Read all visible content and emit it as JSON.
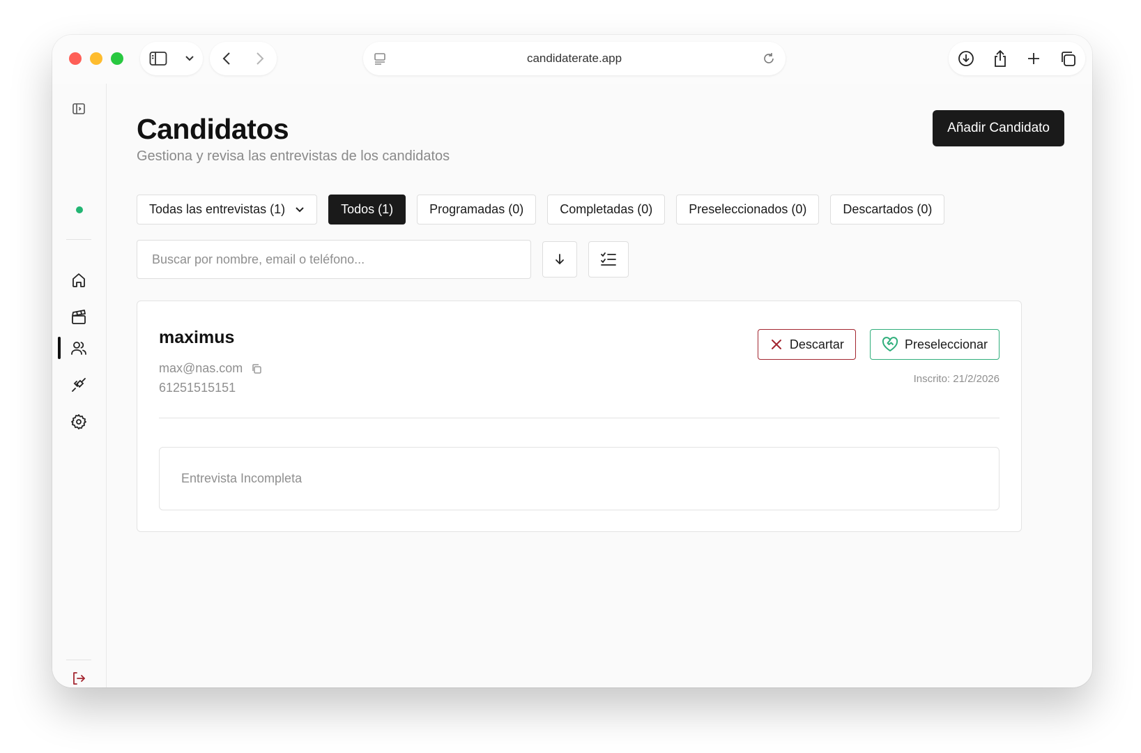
{
  "browser": {
    "url": "candidaterate.app"
  },
  "page": {
    "title": "Candidatos",
    "subtitle": "Gestiona y revisa las entrevistas de los candidatos",
    "add_button": "Añadir Candidato"
  },
  "filters": {
    "interview_dropdown": "Todas las entrevistas (1)",
    "chips": [
      {
        "label": "Todos (1)",
        "active": true
      },
      {
        "label": "Programadas (0)",
        "active": false
      },
      {
        "label": "Completadas (0)",
        "active": false
      },
      {
        "label": "Preseleccionados (0)",
        "active": false
      },
      {
        "label": "Descartados (0)",
        "active": false
      }
    ]
  },
  "search": {
    "placeholder": "Buscar por nombre, email o teléfono...",
    "value": ""
  },
  "candidates": [
    {
      "name": "maximus",
      "email": "max@nas.com",
      "phone": "61251515151",
      "enrolled": "Inscrito: 21/2/2026",
      "discard_label": "Descartar",
      "shortlist_label": "Preseleccionar",
      "interview_status": "Entrevista Incompleta"
    }
  ],
  "sidebar": {
    "icons": [
      "sidebar-toggle-icon",
      "home-icon",
      "clapperboard-icon",
      "users-icon",
      "plug-icon",
      "gear-icon",
      "logout-icon"
    ],
    "active_item": "users-icon"
  },
  "colors": {
    "primary": "#1a1a1a",
    "discard": "#a32630",
    "shortlist": "#2fae7b",
    "status_dot": "#22b573",
    "logout": "#a32630"
  }
}
